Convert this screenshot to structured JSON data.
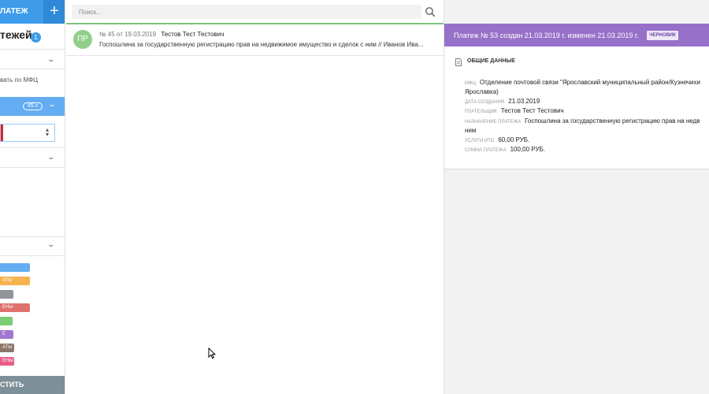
{
  "sidebar": {
    "header_label": "ЛАТЕЖ",
    "add_icon": "+",
    "title": "тежей",
    "count": "1",
    "mfc_checkbox_label": "вать по МФЦ",
    "filter_chip": "45",
    "filter_chip_close": "x",
    "tags": [
      {
        "label": "",
        "color": "#64adf3"
      },
      {
        "label": "АТЫ",
        "color": "#f6b34f"
      },
      {
        "label": "",
        "color": "#8f9598"
      },
      {
        "label": "ЕНЫ",
        "color": "#e0706c"
      },
      {
        "label": "",
        "color": "#7ccb77"
      },
      {
        "label": "Е",
        "color": "#a076d0"
      },
      {
        "label": "АТЫ",
        "color": "#8d756a"
      },
      {
        "label": "ЕНЫ",
        "color": "#e65e87"
      }
    ],
    "bottom_button": "СТИТЬ"
  },
  "search": {
    "placeholder": "Поиск..."
  },
  "list": {
    "items": [
      {
        "avatar": "ПР",
        "number_date": "№ 45 от 19.03.2019",
        "payer": "Тестов Тест Тестович",
        "description": "Госпошлина за государственную регистрацию прав на недвижимое имущество и сделок с ним // Иванов Ива..."
      }
    ]
  },
  "detail": {
    "title": "Платеж № 53 создан 21.03.2019 г. изменен 21.03.2019 г.",
    "status_badge": "ЧЕРНОВИК",
    "section_title": "ОБЩИЕ ДАННЫЕ",
    "fields": {
      "mfc_label": "МФЦ",
      "mfc_value_1": "Отделение почтовой связи \"Ярославский муниципальный район/Кузнечихи",
      "mfc_value_2": "Ярославка)",
      "created_label": "ДАТА СОЗДАНИЯ",
      "created_value": "21.03.2019",
      "payer_label": "ПЛАТЕЛЬЩИК",
      "payer_value": "Тестов Тест Тестович",
      "purpose_label": "НАЗНАЧЕНИЕ ПЛАТЕЖА",
      "purpose_value_1": "Госпошлина за государственную регистрацию прав на недв",
      "purpose_value_2": "ним",
      "services_label": "УСЛУГИ ИТО",
      "services_value": "60,00 РУБ.",
      "amount_label": "СУММА ПЛАТЕЖА",
      "amount_value": "100,00 РУБ."
    }
  },
  "colors": {
    "primary": "#3d9be9",
    "detail_header": "#9771c9",
    "avatar": "#8fcf8a",
    "active_line": "#7ec37e"
  }
}
